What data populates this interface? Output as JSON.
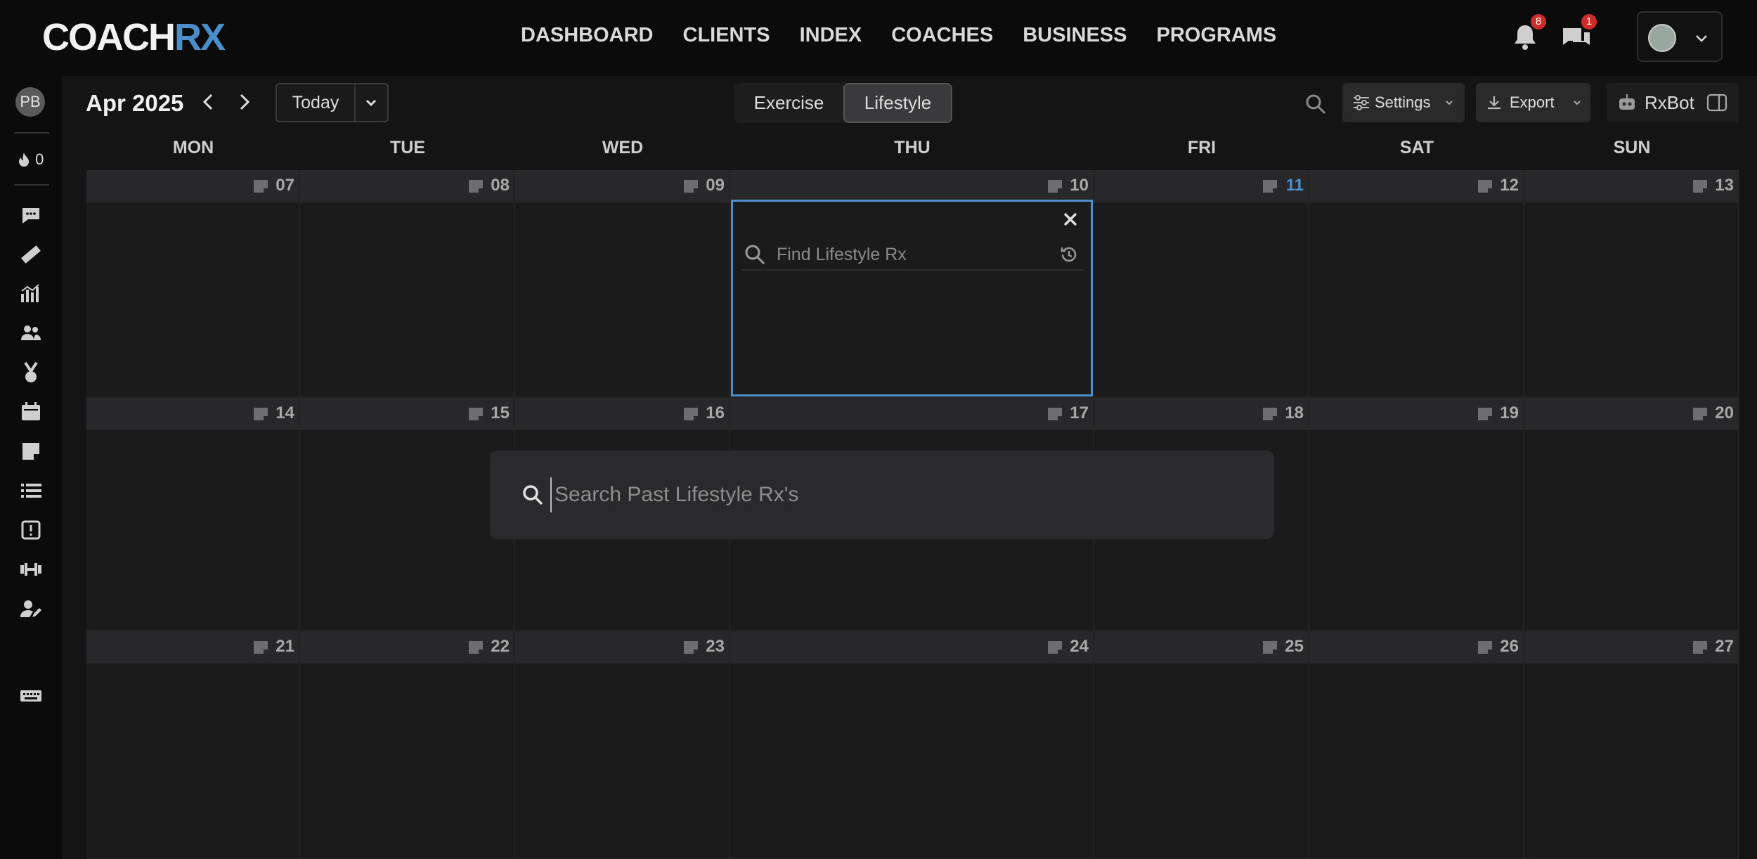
{
  "brand": {
    "name_part1": "COACH",
    "name_part2": "RX"
  },
  "nav": [
    "DASHBOARD",
    "CLIENTS",
    "INDEX",
    "COACHES",
    "BUSINESS",
    "PROGRAMS"
  ],
  "notifications": {
    "bell_count": "8",
    "messages_count": "1"
  },
  "sidebar": {
    "avatar_initials": "PB",
    "streak_count": "0"
  },
  "toolbar": {
    "month": "Apr 2025",
    "today_label": "Today",
    "tabs": [
      "Exercise",
      "Lifestyle"
    ],
    "active_tab": "Lifestyle",
    "settings_label": "Settings",
    "export_label": "Export",
    "rxbot_label": "RxBot"
  },
  "day_headers": [
    "MON",
    "TUE",
    "WED",
    "THU",
    "FRI",
    "SAT",
    "SUN"
  ],
  "weeks": [
    [
      "07",
      "08",
      "09",
      "10",
      "11",
      "12",
      "13"
    ],
    [
      "14",
      "15",
      "16",
      "17",
      "18",
      "19",
      "20"
    ],
    [
      "21",
      "22",
      "23",
      "24",
      "25",
      "26",
      "27"
    ]
  ],
  "today_date": "11",
  "popover": {
    "placeholder": "Find Lifestyle Rx"
  },
  "search_panel": {
    "placeholder": "Search Past Lifestyle Rx's"
  },
  "colors": {
    "accent": "#4a8fc9",
    "badge": "#d02b2b",
    "background": "#141415"
  }
}
